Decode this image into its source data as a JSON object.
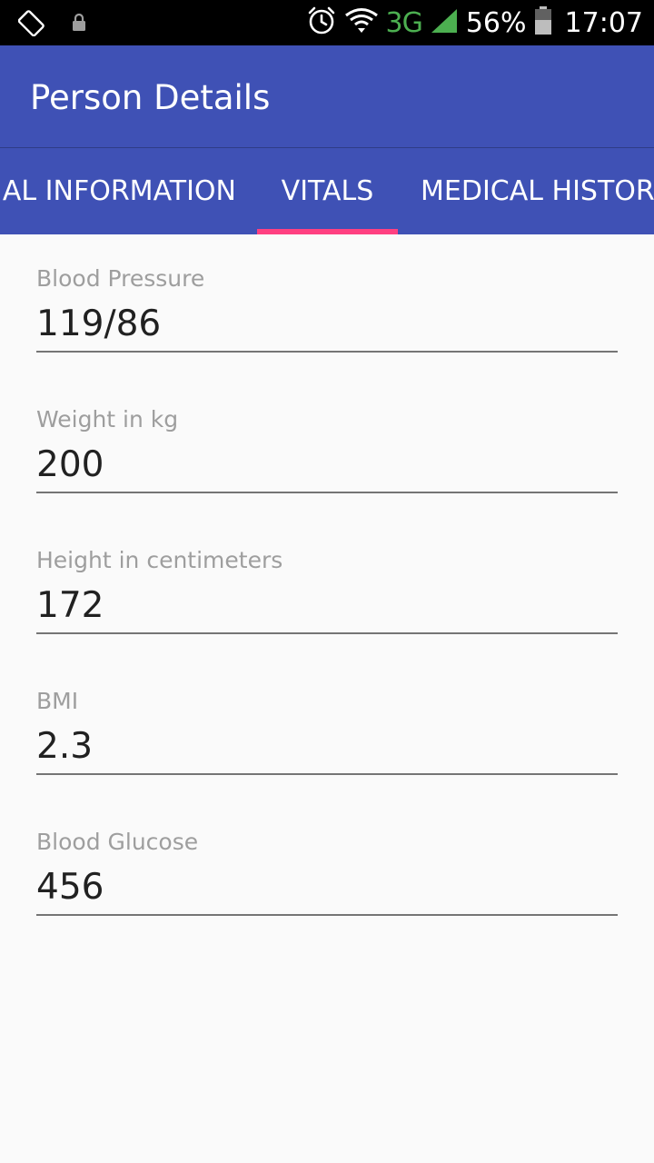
{
  "status_bar": {
    "network": "3G",
    "battery": "56%",
    "time": "17:07"
  },
  "app_bar": {
    "title": "Person Details"
  },
  "tabs": [
    {
      "label": "AL INFORMATION",
      "selected": false
    },
    {
      "label": "VITALS",
      "selected": true
    },
    {
      "label": "MEDICAL HISTOR",
      "selected": false
    }
  ],
  "fields": [
    {
      "label": "Blood Pressure",
      "value": "119/86"
    },
    {
      "label": "Weight in kg",
      "value": "200"
    },
    {
      "label": "Height in centimeters",
      "value": "172"
    },
    {
      "label": "BMI",
      "value": "2.3"
    },
    {
      "label": "Blood Glucose",
      "value": "456"
    }
  ],
  "colors": {
    "primary": "#3f51b5",
    "accent": "#ff4081",
    "status_bar": "#000000",
    "network_green": "#4caf50"
  }
}
